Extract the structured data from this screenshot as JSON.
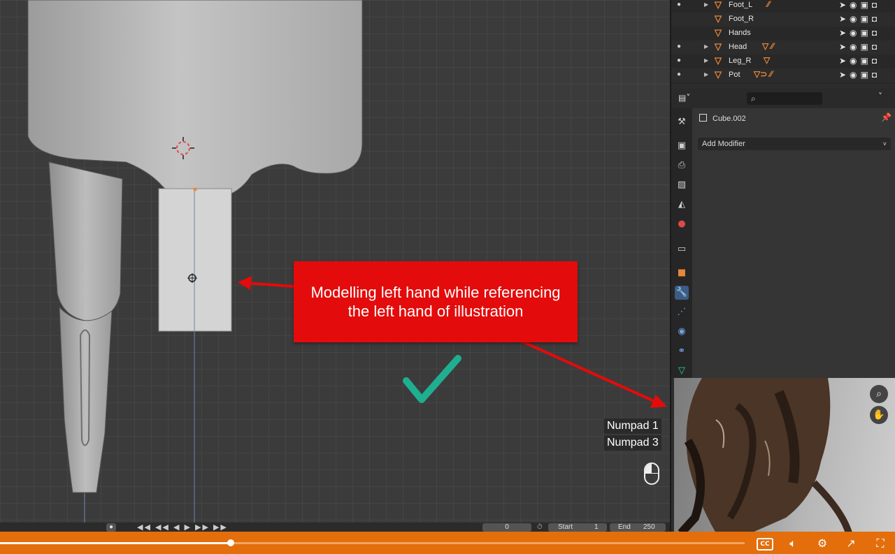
{
  "viewport": {
    "callout_line1": "Modelling left hand while referencing",
    "callout_line2": "the left hand of illustration",
    "key_hints": [
      "Numpad 1",
      "Numpad 3"
    ]
  },
  "timeline": {
    "playback_controls": "◀◀ ◀◀ ◀ ▶ ▶▶ ▶▶",
    "current_frame": "0",
    "start_label": "Start",
    "start_value": "1",
    "end_label": "End",
    "end_value": "250"
  },
  "outliner": {
    "rows": [
      {
        "name": "Foot_L",
        "expandable": true
      },
      {
        "name": "Foot_R",
        "expandable": false
      },
      {
        "name": "Hands",
        "expandable": false
      },
      {
        "name": "Head",
        "expandable": true
      },
      {
        "name": "Leg_R",
        "expandable": true
      },
      {
        "name": "Pot",
        "expandable": true
      }
    ]
  },
  "properties": {
    "search_placeholder": "⌕",
    "object_name": "Cube.002",
    "add_modifier_label": "Add Modifier"
  },
  "player": {
    "progress_percent": 31
  },
  "colors": {
    "accent_orange": "#e36e0b",
    "callout_red": "#e30b0b",
    "check_teal": "#1fae8f",
    "mesh_icon": "#e8873a"
  }
}
